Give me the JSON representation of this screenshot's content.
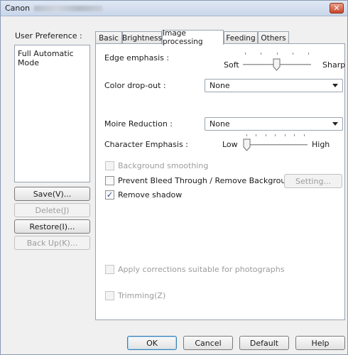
{
  "window": {
    "title_prefix": "Canon",
    "close_glyph": "✕"
  },
  "sidebar": {
    "user_preference_label": "User Preference :",
    "preferences": [
      "Full Automatic Mode"
    ],
    "buttons": {
      "save": "Save(V)...",
      "delete": "Delete(J)",
      "restore": "Restore(I)...",
      "backup": "Back Up(K)..."
    }
  },
  "tabs": [
    "Basic",
    "Brightness",
    "Image processing",
    "Feeding",
    "Others"
  ],
  "active_tab": "Image processing",
  "panel": {
    "edge_emphasis": {
      "label": "Edge emphasis :",
      "min_label": "Soft",
      "max_label": "Sharp",
      "value_fraction": 0.5
    },
    "color_dropout": {
      "label": "Color drop-out :",
      "value": "None"
    },
    "moire_reduction": {
      "label": "Moire Reduction :",
      "value": "None"
    },
    "character_emphasis": {
      "label": "Character Emphasis :",
      "min_label": "Low",
      "max_label": "High",
      "value_fraction": 0.0
    },
    "background_smoothing": {
      "label": "Background smoothing",
      "checked": false,
      "enabled": false
    },
    "prevent_bleed": {
      "label": "Prevent Bleed Through / Remove Background",
      "checked": false,
      "enabled": true
    },
    "setting_button": "Setting...",
    "remove_shadow": {
      "label": "Remove shadow",
      "checked": true,
      "enabled": true
    },
    "apply_corrections": {
      "label": "Apply corrections suitable for photographs",
      "checked": false,
      "enabled": false
    },
    "trimming": {
      "label": "Trimming(Z)",
      "checked": false,
      "enabled": false
    }
  },
  "footer": {
    "ok": "OK",
    "cancel": "Cancel",
    "default": "Default",
    "help": "Help"
  },
  "colors": {
    "title_bg": "#c9d6ea",
    "close_button": "#c9452a",
    "check_mark": "#2a3f8a"
  }
}
